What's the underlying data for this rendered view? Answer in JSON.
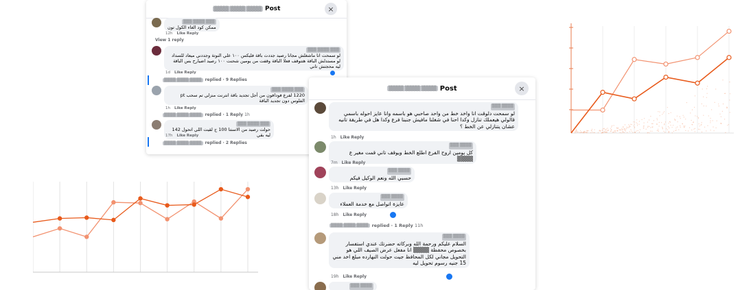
{
  "window1": {
    "title": "Post",
    "title_prefix": "▒▒▒▒ ▒▒▒▒ ▒▒▒▒",
    "close": "×",
    "view_reply": "View 1 reply",
    "comments": [
      {
        "name": "▒▒▒ ▒▒▒▒ ▒▒▒",
        "text": "ممكن كود الغاء الكول تون",
        "time": "12h",
        "like": "Like",
        "reply": "Reply"
      },
      {
        "name": "▒▒▒ ▒▒▒▒ ▒▒▒",
        "text": "لو سمحت انا ماشغلش مجانا رصيد جددت باقة فليكس ١٠٠ علي النوتة وجددني ميعاد للسداد لو مستدلش الباقة هتتوقف فعلا الباقة وقفت من يومين شحنت ١٠٠ رصيد اضيارح بس الباقة ليه محجتش تاني",
        "time": "1d",
        "like": "Like",
        "reply": "Reply"
      },
      {
        "name": "▒▒▒ ▒▒▒▒ ▒▒▒",
        "text": "1220 لفرع فودافون من أجل تجديد باقة انترنت منزلي تم سحب pt الفلوس دون تجديد الباقة",
        "time": "1h",
        "like": "Like",
        "reply": "Reply"
      },
      {
        "name": "▒▒▒ ▒▒▒▒ ▒▒▒",
        "text": "حولت رصيد من الاسنتا 100 ج لقيت اللي اتحول 142 ليه بقي",
        "time": "17h",
        "like": "Like",
        "reply": "Reply"
      }
    ],
    "reply_rows": [
      {
        "who": "▒▒▒▒ ▒▒▒▒ ▒▒▒▒",
        "text": "replied · 9 Replies"
      },
      {
        "who": "▒▒▒▒ ▒▒▒▒ ▒▒▒▒",
        "text": "replied · 1 Reply",
        "time": "1h"
      },
      {
        "who": "▒▒▒▒ ▒▒▒▒ ▒▒▒▒",
        "text": "replied · 2 Replies"
      }
    ]
  },
  "window2": {
    "title": "Post",
    "title_prefix": "▒▒▒▒ ▒▒▒▒ ▒▒▒▒",
    "close": "×",
    "comments": [
      {
        "name": "▒▒▒ ▒▒▒▒",
        "text": "لو سمحت دلوقت انا واخد خط من واحد صاحبي هو باسمه وانا عايز احوله باسمي قالولي هيعملك تنازل وكدا احنا في شغلنا مافيش جنبنا فرع وكدا هل في طريقة تانيه عشان يتنازلي عن الخط ؟",
        "time": "1h",
        "like": "Like",
        "reply": "Reply"
      },
      {
        "name": "▒▒▒ ▒▒▒▒",
        "text": "كل يومين اروح الفرع اطلع الخط ويوقف تاني قمت مغير ع ▒▒▒▒",
        "time": "7m",
        "like": "Like",
        "reply": "Reply"
      },
      {
        "name": "▒▒▒ ▒▒▒▒",
        "text": "حسبي الله ونعم الوكيل فيكم",
        "time": "13h",
        "like": "Like",
        "reply": "Reply"
      },
      {
        "name": "▒▒▒ ▒▒▒▒",
        "text": "عايزة اتواصل مع خدمة العملاء",
        "time": "18h",
        "like": "Like",
        "reply": "Reply"
      },
      {
        "name": "▒▒▒ ▒▒▒▒",
        "text": "السلام عليكم ورحمة الله وبركاته حضرتك عندي استفسار بخصوص محفظة ▒▒▒▒ انا مفعل عرض الصيف اللي هو التحويل مجاني لكل المحافظ جيت حولت النهارده مبلغ اخد مني 15 جنيه رسوم تحويل ليه",
        "time": "19h",
        "like": "Like",
        "reply": "Reply"
      },
      {
        "name": "▒▒▒ ▒▒▒▒",
        "text": ""
      }
    ],
    "reply_rows": [
      {
        "who": "▒▒▒▒ ▒▒▒▒ ▒▒▒▒",
        "text": "replied · 1 Reply",
        "time": "11h"
      }
    ]
  },
  "colors": {
    "chart_dark": "#e85a1b",
    "chart_light": "#f29270",
    "facebook_blue": "#1877f2",
    "bubble": "#f0f2f5"
  },
  "chart_data": [
    {
      "type": "line",
      "title": "",
      "xlabel": "",
      "ylabel": "",
      "x": [
        0,
        1,
        2,
        3,
        4,
        5,
        6,
        7,
        8
      ],
      "series": [
        {
          "values": [
            0.65,
            0.7,
            0.71,
            0.68,
            0.96,
            0.87,
            0.88,
            1.08,
            0.98
          ]
        },
        {
          "values": [
            0.46,
            0.57,
            0.46,
            0.91,
            0.9,
            0.69,
            0.92,
            0.7,
            1.08
          ]
        }
      ],
      "ylim": [
        0,
        1.5
      ],
      "grid": "vertical"
    },
    {
      "type": "line",
      "title": "",
      "xlabel": "",
      "ylabel": "",
      "x": [
        0,
        1,
        2,
        3,
        4
      ],
      "series": [
        {
          "values": [
            0.0,
            0.62,
            0.52,
            0.85,
            0.76,
            1.15
          ]
        },
        {
          "values": [
            0.35,
            0.35,
            1.12,
            1.05,
            1.15,
            1.55
          ]
        }
      ],
      "ylim": [
        0,
        1.65
      ],
      "grid": "vertical"
    }
  ]
}
